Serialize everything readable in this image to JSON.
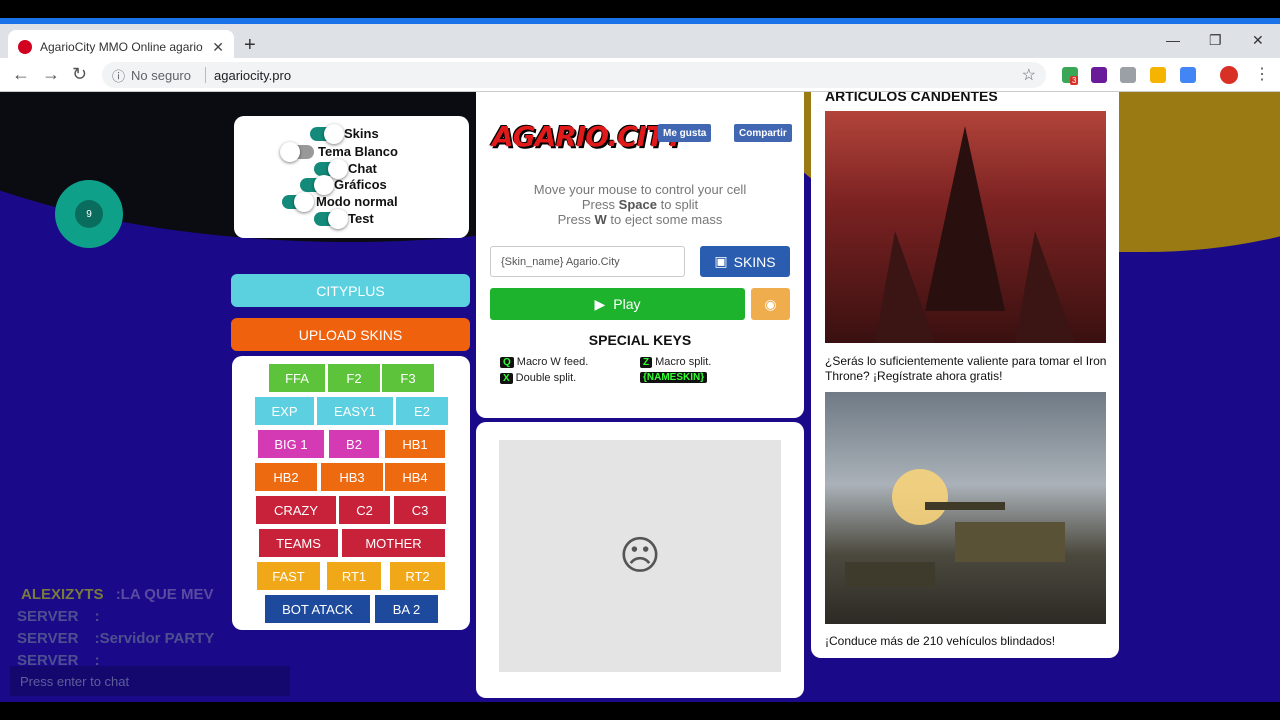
{
  "browser": {
    "tab_title": "AgarioCity MMO Online agario p",
    "tab_close": "✕",
    "new_tab": "+",
    "url_security": "No seguro",
    "url": "agariocity.pro",
    "win_min": "—",
    "win_restore": "❐",
    "win_close": "✕",
    "ext_badge": "3"
  },
  "settings": {
    "options": [
      {
        "label": "Skins",
        "on": true
      },
      {
        "label": "Tema Blanco",
        "on": false
      },
      {
        "label": "Chat",
        "on": true
      },
      {
        "label": "Gráficos",
        "on": true
      },
      {
        "label": "Modo normal",
        "on": false
      },
      {
        "label": "Test",
        "on": true
      }
    ]
  },
  "buttons": {
    "cityplus": "CITYPLUS",
    "upload": "UPLOAD SKINS"
  },
  "modes": [
    "FFA",
    "F2",
    "F3",
    "EXP",
    "EASY1",
    "E2",
    "BIG 1",
    "B2",
    "HB1",
    "HB2",
    "HB3",
    "HB4",
    "CRAZY",
    "C2",
    "C3",
    "TEAMS",
    "MOTHER",
    "FAST",
    "RT1",
    "RT2",
    "BOT ATACK",
    "BA 2"
  ],
  "center": {
    "logo": "AGARIO.CITY",
    "like": "Me gusta",
    "share": "Compartir",
    "help1": "Move your mouse to control your cell",
    "help2_pre": "Press ",
    "help2_key": "Space",
    "help2_post": " to split",
    "help3_pre": "Press ",
    "help3_key": "W",
    "help3_post": " to eject some mass",
    "skin_placeholder": "{Skin_name} Agario.City",
    "skins_btn": "SKINS",
    "play": "Play",
    "special_keys": "SPECIAL KEYS",
    "keys": [
      {
        "k": "Q",
        "t": "Macro W feed."
      },
      {
        "k": "Z",
        "t": "Macro split."
      },
      {
        "k": "X",
        "t": "Double split."
      },
      {
        "k": "{NAMESKIN}",
        "t": ""
      }
    ]
  },
  "right": {
    "title": "ARTICULOS CANDENTES",
    "caption1": "¿Serás lo suficientemente valiente para tomar el Iron Throne? ¡Regístrate ahora gratis!",
    "caption2": "¡Conduce más de 210 vehículos blindados!"
  },
  "cell_label": "9",
  "chat": {
    "lines": [
      {
        "name": "ALEXIZYTS",
        "msg": ":LA QUE MEV"
      },
      {
        "name": "SERVER",
        "msg": ":"
      },
      {
        "name": "SERVER",
        "msg": ":Servidor PARTY"
      },
      {
        "name": "SERVER",
        "msg": ":"
      }
    ],
    "placeholder": "Press enter to chat"
  }
}
